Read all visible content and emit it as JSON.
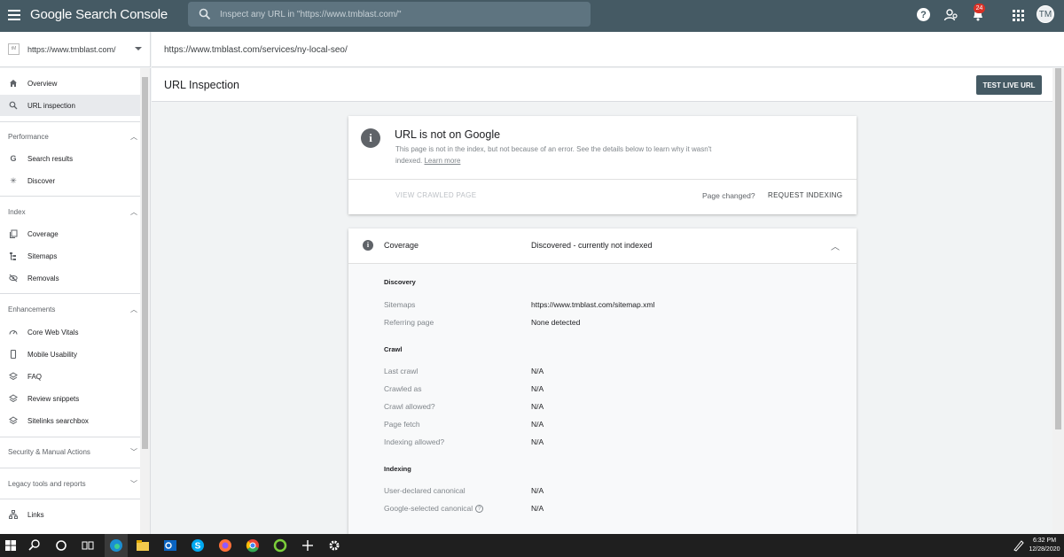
{
  "app": {
    "title": "Google Search Console",
    "notification_count": "24",
    "avatar_initials": "TM"
  },
  "search": {
    "placeholder": "Inspect any URL in \"https://www.tmblast.com/\""
  },
  "property": {
    "name": "https://www.tmblast.com/"
  },
  "inspected_url": "https://www.tmblast.com/services/ny-local-seo/",
  "sidebar": {
    "overview": "Overview",
    "url_inspection": "URL inspection",
    "performance": {
      "label": "Performance",
      "items": [
        "Search results",
        "Discover"
      ]
    },
    "index": {
      "label": "Index",
      "items": [
        "Coverage",
        "Sitemaps",
        "Removals"
      ]
    },
    "enhancements": {
      "label": "Enhancements",
      "items": [
        "Core Web Vitals",
        "Mobile Usability",
        "FAQ",
        "Review snippets",
        "Sitelinks searchbox"
      ]
    },
    "security": "Security & Manual Actions",
    "legacy": "Legacy tools and reports",
    "links": "Links"
  },
  "page": {
    "title": "URL Inspection",
    "test_live_button": "TEST LIVE URL"
  },
  "status": {
    "title": "URL is not on Google",
    "description": "This page is not in the index, but not because of an error. See the details below to learn why it wasn't indexed.",
    "learn_more": "Learn more",
    "view_crawled": "VIEW CRAWLED PAGE",
    "page_changed": "Page changed?",
    "request_indexing": "REQUEST INDEXING"
  },
  "coverage": {
    "label": "Coverage",
    "value": "Discovered - currently not indexed",
    "discovery": {
      "heading": "Discovery",
      "rows": [
        {
          "key": "Sitemaps",
          "value": "https://www.tmblast.com/sitemap.xml"
        },
        {
          "key": "Referring page",
          "value": "None detected"
        }
      ]
    },
    "crawl": {
      "heading": "Crawl",
      "rows": [
        {
          "key": "Last crawl",
          "value": "N/A"
        },
        {
          "key": "Crawled as",
          "value": "N/A"
        },
        {
          "key": "Crawl allowed?",
          "value": "N/A"
        },
        {
          "key": "Page fetch",
          "value": "N/A"
        },
        {
          "key": "Indexing allowed?",
          "value": "N/A"
        }
      ]
    },
    "indexing": {
      "heading": "Indexing",
      "rows": [
        {
          "key": "User-declared canonical",
          "value": "N/A"
        },
        {
          "key": "Google-selected canonical",
          "value": "N/A"
        }
      ]
    }
  },
  "taskbar": {
    "time": "6:32 PM",
    "date": "12/28/2020"
  },
  "colors": {
    "topbar": "#455a64",
    "button": "#455a64",
    "badge": "#d93025"
  }
}
